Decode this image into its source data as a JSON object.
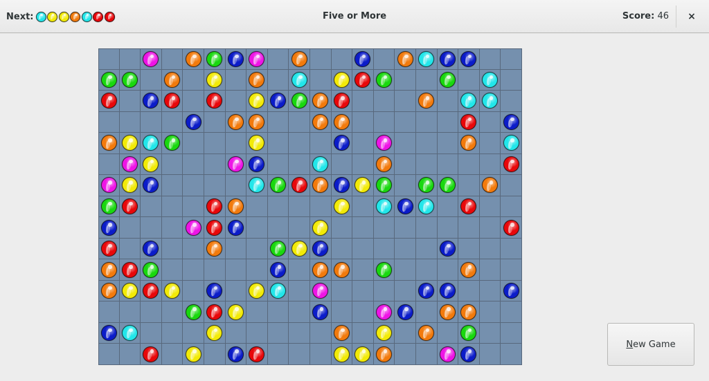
{
  "header": {
    "next_label": "Next:",
    "next_balls": [
      "cyan",
      "yellow",
      "yellow",
      "orange",
      "cyan",
      "red",
      "red"
    ],
    "title": "Five or More",
    "score_label": "Score:",
    "score_value": "46",
    "close_icon": "close-icon",
    "close_glyph": "×"
  },
  "colors": {
    "red": "#e8070a",
    "orange": "#f27a0c",
    "yellow": "#f2ea07",
    "green": "#19d80f",
    "cyan": "#22e6ea",
    "blue": "#0b1cc9",
    "magenta": "#ee14e6",
    "board_bg": "#7590ae",
    "grid_line": "#58687c"
  },
  "board": {
    "columns": 20,
    "rows_count": 15,
    "rows": [
      [
        null,
        null,
        "magenta",
        null,
        "orange",
        "green",
        "blue",
        "magenta",
        null,
        "orange",
        null,
        null,
        "blue",
        null,
        "orange",
        "cyan",
        "blue",
        "blue",
        null,
        null
      ],
      [
        "green",
        "green",
        null,
        "orange",
        null,
        "yellow",
        null,
        "orange",
        null,
        "cyan",
        null,
        "yellow",
        "red",
        "green",
        null,
        null,
        "green",
        null,
        "cyan",
        null
      ],
      [
        "red",
        null,
        "blue",
        "red",
        null,
        "red",
        null,
        "yellow",
        "blue",
        "green",
        "orange",
        "red",
        null,
        null,
        null,
        "orange",
        null,
        "cyan",
        "cyan",
        null
      ],
      [
        null,
        null,
        null,
        null,
        "blue",
        null,
        "orange",
        "orange",
        null,
        null,
        "orange",
        "orange",
        null,
        null,
        null,
        null,
        null,
        "red",
        null,
        "blue"
      ],
      [
        "orange",
        "yellow",
        "cyan",
        "green",
        null,
        null,
        null,
        "yellow",
        null,
        null,
        null,
        "blue",
        null,
        "magenta",
        null,
        null,
        null,
        "orange",
        null,
        "cyan"
      ],
      [
        null,
        "magenta",
        "yellow",
        null,
        null,
        null,
        "magenta",
        "blue",
        null,
        null,
        "cyan",
        null,
        null,
        "orange",
        null,
        null,
        null,
        null,
        null,
        "red"
      ],
      [
        "magenta",
        "yellow",
        "blue",
        null,
        null,
        null,
        null,
        "cyan",
        "green",
        "red",
        "orange",
        "blue",
        "yellow",
        "green",
        null,
        "green",
        "green",
        null,
        "orange",
        null
      ],
      [
        "green",
        "red",
        null,
        null,
        null,
        "red",
        "orange",
        null,
        null,
        null,
        null,
        "yellow",
        null,
        "cyan",
        "blue",
        "cyan",
        null,
        "red",
        null,
        null
      ],
      [
        "blue",
        null,
        null,
        null,
        "magenta",
        "red",
        "blue",
        null,
        null,
        null,
        "yellow",
        null,
        null,
        null,
        null,
        null,
        null,
        null,
        null,
        "red"
      ],
      [
        "red",
        null,
        "blue",
        null,
        null,
        "orange",
        null,
        null,
        "green",
        "yellow",
        "blue",
        null,
        null,
        null,
        null,
        null,
        "blue",
        null,
        null,
        null
      ],
      [
        "orange",
        "red",
        "green",
        null,
        null,
        null,
        null,
        null,
        "blue",
        null,
        "orange",
        "orange",
        null,
        "green",
        null,
        null,
        null,
        "orange",
        null,
        null
      ],
      [
        "orange",
        "yellow",
        "red",
        "yellow",
        null,
        "blue",
        null,
        "yellow",
        "cyan",
        null,
        "magenta",
        null,
        null,
        null,
        null,
        "blue",
        "blue",
        null,
        null,
        "blue"
      ],
      [
        null,
        null,
        null,
        null,
        "green",
        "red",
        "yellow",
        null,
        null,
        null,
        "blue",
        null,
        null,
        "magenta",
        "blue",
        null,
        "orange",
        "orange",
        null,
        null
      ],
      [
        "blue",
        "cyan",
        null,
        null,
        null,
        "yellow",
        null,
        null,
        null,
        null,
        null,
        "orange",
        null,
        "yellow",
        null,
        "orange",
        null,
        "green",
        null,
        null
      ],
      [
        null,
        null,
        "red",
        null,
        "yellow",
        null,
        "blue",
        "red",
        null,
        null,
        null,
        "yellow",
        "yellow",
        "orange",
        null,
        null,
        "magenta",
        "blue",
        null,
        null
      ]
    ]
  },
  "new_game": {
    "mnemonic": "N",
    "rest": "ew Game",
    "label": "New Game"
  }
}
